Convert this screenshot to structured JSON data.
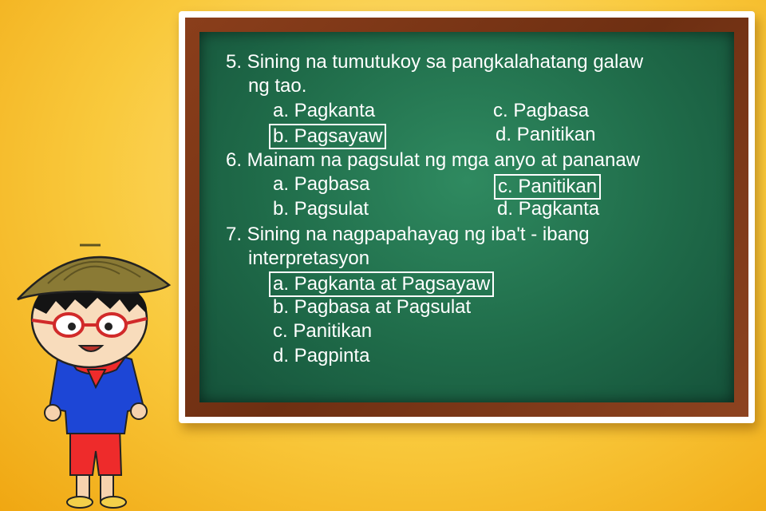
{
  "questions": [
    {
      "stem_line1": "5. Sining na tumutukoy sa pangkalahatang galaw",
      "stem_line2": "ng tao.",
      "choices": {
        "a": "a. Pagkanta",
        "b": "b. Pagsayaw",
        "c": "c. Pagbasa",
        "d": "d. Panitikan"
      },
      "answer": "b"
    },
    {
      "stem_line1": "6. Mainam na pagsulat ng mga anyo at pananaw",
      "choices": {
        "a": "a. Pagbasa",
        "b": "b. Pagsulat",
        "c": "c. Panitikan",
        "d": "d. Pagkanta"
      },
      "answer": "c"
    },
    {
      "stem_line1": "7. Sining na nagpapahayag ng iba't - ibang",
      "stem_line2": "interpretasyon",
      "choices": {
        "a": "a. Pagkanta at Pagsayaw",
        "b": "b. Pagbasa at Pagsulat",
        "c": "c. Panitikan",
        "d": "d. Pagpinta"
      },
      "answer": "a"
    }
  ],
  "colors": {
    "background": "#f9c93c",
    "board": "#1f6b49",
    "frame": "#6e2f12",
    "text": "#ffffff"
  },
  "illustration": "cartoon-boy-salakot-hat"
}
